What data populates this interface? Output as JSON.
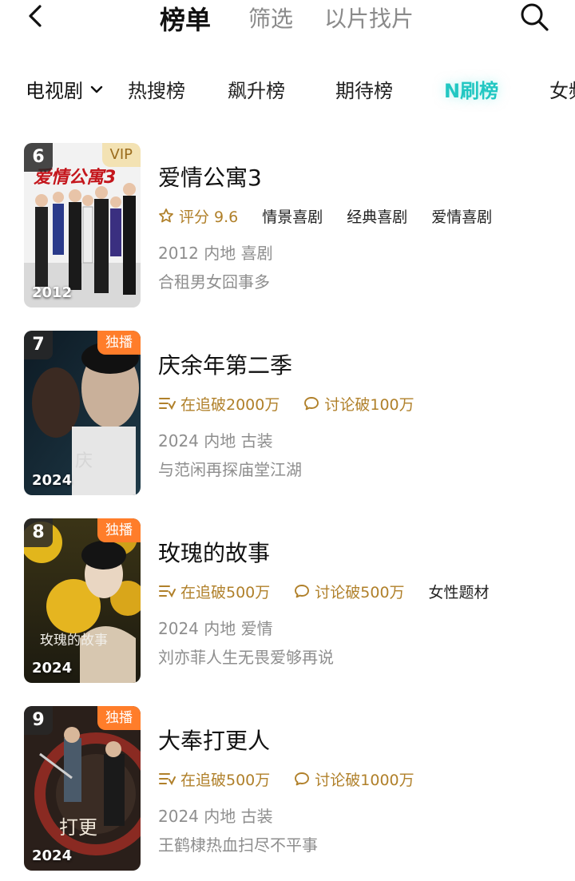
{
  "header": {
    "tabs": [
      {
        "label": "榜单"
      },
      {
        "label": "筛选"
      },
      {
        "label": "以片找片"
      }
    ]
  },
  "categories": {
    "dropdown_label": "电视剧",
    "tabs": [
      {
        "label": "热搜榜"
      },
      {
        "label": "飙升榜"
      },
      {
        "label": "期待榜"
      },
      {
        "label": "N刷榜"
      },
      {
        "label": "女频"
      }
    ],
    "active_color": "#22c7c2"
  },
  "items": [
    {
      "rank": "6",
      "badge": "VIP",
      "year_overlay": "2012",
      "title": "爱情公寓3",
      "rating": "评分 9.6",
      "tags": [
        "情景喜剧",
        "经典喜剧",
        "爱情喜剧"
      ],
      "info": "2012 内地 喜剧",
      "desc": "合租男女囧事多"
    },
    {
      "rank": "7",
      "badge": "独播",
      "year_overlay": "2024",
      "title": "庆余年第二季",
      "follow": "在追破2000万",
      "discuss": "讨论破100万",
      "tags": [],
      "info": "2024 内地 古装",
      "desc": "与范闲再探庙堂江湖"
    },
    {
      "rank": "8",
      "badge": "独播",
      "year_overlay": "2024",
      "title": "玫瑰的故事",
      "follow": "在追破500万",
      "discuss": "讨论破500万",
      "tags": [
        "女性题材"
      ],
      "info": "2024 内地 爱情",
      "desc": "刘亦菲人生无畏爱够再说"
    },
    {
      "rank": "9",
      "badge": "独播",
      "year_overlay": "2024",
      "title": "大奉打更人",
      "follow": "在追破500万",
      "discuss": "讨论破1000万",
      "tags": [],
      "info": "2024 内地 古装",
      "desc": "王鹤棣热血扫尽不平事"
    }
  ],
  "icons": {
    "back": "chevron-left-icon",
    "search": "search-icon",
    "dropdown": "chevron-down-icon",
    "rating": "star-outline-icon",
    "follow": "list-follow-icon",
    "discuss": "chat-bubble-icon"
  },
  "colors": {
    "gold_meta": "#b0802a",
    "exclusive_badge": "#ff7d2a",
    "vip_badge": "#f3e2b3"
  }
}
